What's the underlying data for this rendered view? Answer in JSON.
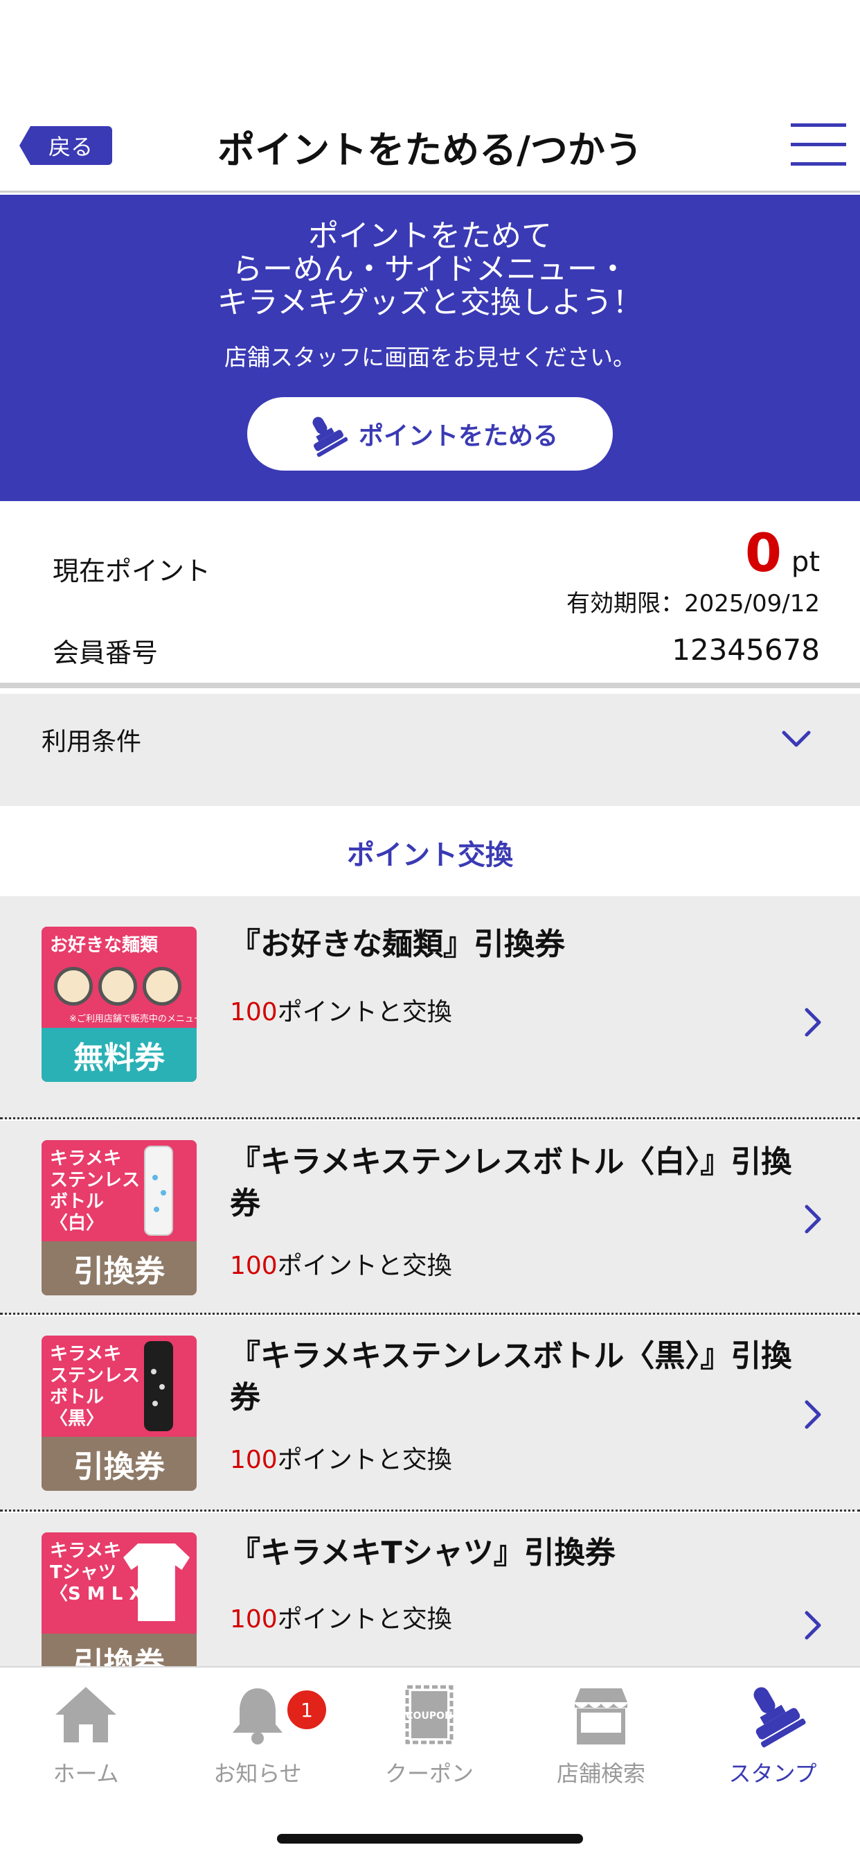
{
  "header": {
    "back_label": "戻る",
    "title": "ポイントをためる/つかう",
    "menu_icon": "hamburger-icon"
  },
  "banner": {
    "line1": "ポイントをためて",
    "line2": "らーめん・サイドメニュー・",
    "line3": "キラメキグッズと交換しよう！",
    "note": "店舗スタッフに画面をお見せください。",
    "button_label": "ポイントをためる",
    "button_icon": "stamp-icon"
  },
  "points": {
    "current_label": "現在ポイント",
    "value": "0",
    "unit": "pt",
    "expiry": "有効期限：2025/09/12",
    "member_label": "会員番号",
    "member_number": "12345678"
  },
  "terms": {
    "label": "利用条件",
    "icon": "chevron-down-icon"
  },
  "exchange": {
    "heading": "ポイント交換",
    "items": [
      {
        "title": "『お好きな麺類』引換券",
        "points": "100",
        "points_suffix": "ポイントと交換",
        "thumb_top": "お好きな麺類",
        "thumb_small": "※ご利用店舗で販売中のメニュー",
        "thumb_bottom": "無料券"
      },
      {
        "title": "『キラメキステンレスボトル〈白〉』引換券",
        "points": "100",
        "points_suffix": "ポイントと交換",
        "thumb_top": "キラメキ\nステンレス\nボトル\n〈白〉",
        "thumb_bottom": "引換券"
      },
      {
        "title": "『キラメキステンレスボトル〈黒〉』引換券",
        "points": "100",
        "points_suffix": "ポイントと交換",
        "thumb_top": "キラメキ\nステンレス\nボトル\n〈黒〉",
        "thumb_bottom": "引換券"
      },
      {
        "title": "『キラメキTシャツ』引換券",
        "points": "100",
        "points_suffix": "ポイントと交換",
        "thumb_top": "キラメキ\nTシャツ\n〈S M L XL〉",
        "thumb_bottom": "引換券"
      }
    ]
  },
  "tabbar": {
    "items": [
      {
        "label": "ホーム",
        "icon": "home-icon"
      },
      {
        "label": "お知らせ",
        "icon": "bell-icon",
        "badge": "1"
      },
      {
        "label": "クーポン",
        "icon": "coupon-icon",
        "icon_text": "COUPON"
      },
      {
        "label": "店舗検索",
        "icon": "store-icon"
      },
      {
        "label": "スタンプ",
        "icon": "stamp-icon",
        "active": true
      }
    ]
  },
  "colors": {
    "brand": "#3a3ab5",
    "accent_red": "#d40000",
    "badge_red": "#e2231a",
    "ticket_pink": "#e83c6a",
    "ticket_teal": "#2ab1b6",
    "ticket_brown": "#8f7a68"
  }
}
